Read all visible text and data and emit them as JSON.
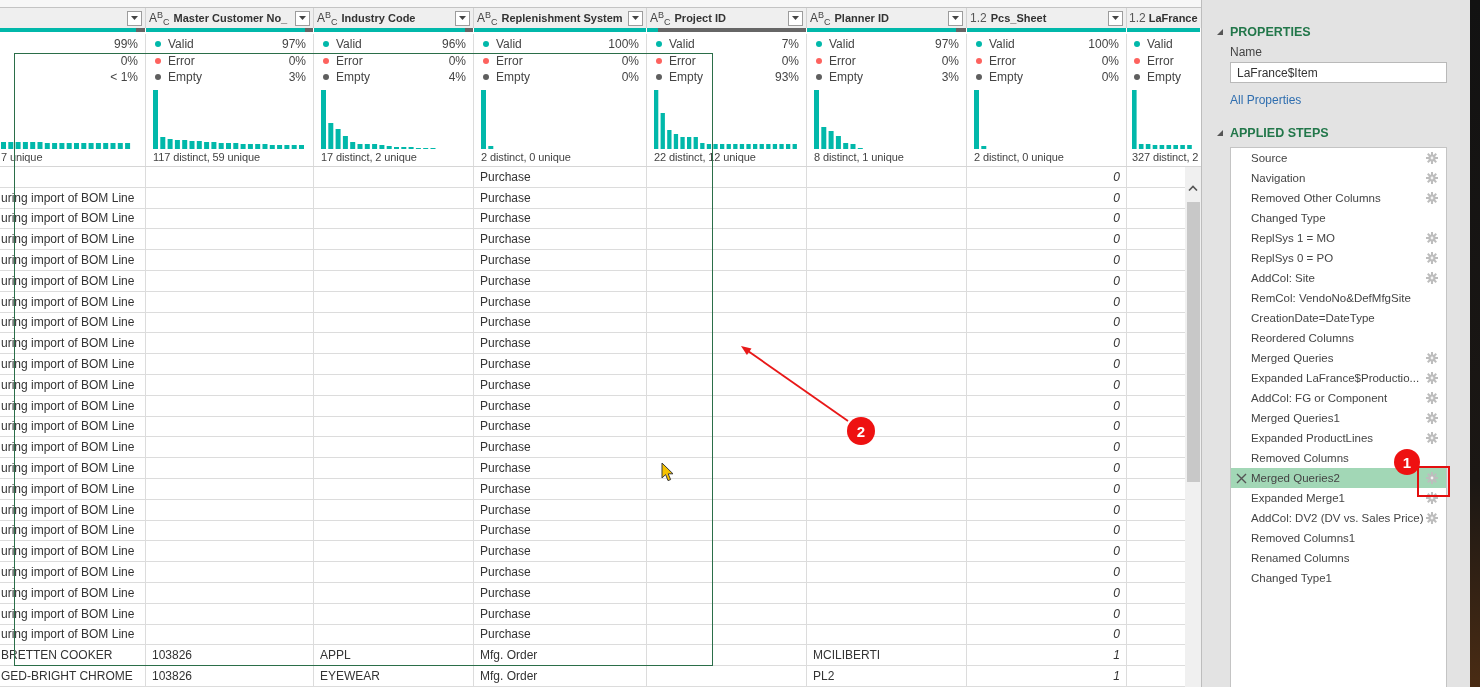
{
  "table": {
    "columns": [
      {
        "kind": "text",
        "has_filter": true,
        "quality_bar": {
          "level": 0.94
        },
        "quality": [
          {
            "value": "99%"
          },
          {
            "value": "0%"
          },
          {
            "value": "< 1%"
          }
        ],
        "distinct": "7 unique"
      },
      {
        "kind": "text",
        "type_label": "A$^{B}$$_{C}$",
        "name": "Master Customer No_",
        "has_filter": true,
        "quality_bar": {
          "level": 0.95
        },
        "quality": [
          {
            "label": "Valid",
            "value": "97%",
            "color": "#01b8aa"
          },
          {
            "label": "Error",
            "value": "0%",
            "color": "#fd625e"
          },
          {
            "label": "Empty",
            "value": "3%",
            "color": "#5f5f5f"
          }
        ],
        "distinct": "117 distinct, 59 unique"
      },
      {
        "kind": "text",
        "type_label": "A$^{B}$$_{C}$",
        "name": "Industry Code",
        "has_filter": true,
        "quality_bar": {
          "level": 0.95
        },
        "quality": [
          {
            "label": "Valid",
            "value": "96%",
            "color": "#01b8aa"
          },
          {
            "label": "Error",
            "value": "0%",
            "color": "#fd625e"
          },
          {
            "label": "Empty",
            "value": "4%",
            "color": "#5f5f5f"
          }
        ],
        "distinct": "17 distinct, 2 unique"
      },
      {
        "kind": "text",
        "type_label": "A$^{B}$$_{C}$",
        "name": "Replenishment System",
        "has_filter": true,
        "quality_bar": {
          "level": 1
        },
        "quality": [
          {
            "label": "Valid",
            "value": "100%",
            "color": "#01b8aa"
          },
          {
            "label": "Error",
            "value": "0%",
            "color": "#fd625e"
          },
          {
            "label": "Empty",
            "value": "0%",
            "color": "#5f5f5f"
          }
        ],
        "distinct": "2 distinct, 0 unique"
      },
      {
        "kind": "text",
        "type_label": "A$^{B}$$_{C}$",
        "name": "Project ID",
        "has_filter": true,
        "quality_bar": {
          "level": 0.07
        },
        "quality": [
          {
            "label": "Valid",
            "value": "7%",
            "color": "#01b8aa"
          },
          {
            "label": "Error",
            "value": "0%",
            "color": "#fd625e"
          },
          {
            "label": "Empty",
            "value": "93%",
            "color": "#5f5f5f"
          }
        ],
        "distinct": "22 distinct, 12 unique"
      },
      {
        "kind": "text",
        "type_label": "A$^{B}$$_{C}$",
        "name": "Planner ID",
        "has_filter": true,
        "quality_bar": {
          "level": 0.94
        },
        "quality": [
          {
            "label": "Valid",
            "value": "97%",
            "color": "#01b8aa"
          },
          {
            "label": "Error",
            "value": "0%",
            "color": "#fd625e"
          },
          {
            "label": "Empty",
            "value": "3%",
            "color": "#5f5f5f"
          }
        ],
        "distinct": "8 distinct, 1 unique"
      },
      {
        "kind": "number",
        "type_label": "1.2",
        "name": "Pcs_Sheet",
        "has_filter": true,
        "quality_bar": {
          "level": 1
        },
        "quality": [
          {
            "label": "Valid",
            "value": "100%",
            "color": "#01b8aa"
          },
          {
            "label": "Error",
            "value": "0%",
            "color": "#fd625e"
          },
          {
            "label": "Empty",
            "value": "0%",
            "color": "#5f5f5f"
          }
        ],
        "distinct": "2 distinct, 0 unique"
      },
      {
        "kind": "number",
        "type_label": "1.2",
        "name": "LaFrance",
        "has_filter": false,
        "quality_bar": {
          "level": 1
        },
        "quality": [
          {
            "label": "Valid",
            "color": "#01b8aa"
          },
          {
            "label": "Error",
            "color": "#fd625e"
          },
          {
            "label": "Empty",
            "color": "#5f5f5f"
          }
        ],
        "distinct": "327 distinct, 2"
      }
    ],
    "rows": [
      {
        "replenishment_system": "Purchase",
        "pcs_sheet": "0"
      },
      {
        "column_1": "uring import of BOM Line",
        "replenishment_system": "Purchase",
        "pcs_sheet": "0"
      },
      {
        "column_1": "uring import of BOM Line",
        "replenishment_system": "Purchase",
        "pcs_sheet": "0"
      },
      {
        "column_1": "uring import of BOM Line",
        "replenishment_system": "Purchase",
        "pcs_sheet": "0"
      },
      {
        "column_1": "uring import of BOM Line",
        "replenishment_system": "Purchase",
        "pcs_sheet": "0"
      },
      {
        "column_1": "uring import of BOM Line",
        "replenishment_system": "Purchase",
        "pcs_sheet": "0"
      },
      {
        "column_1": "uring import of BOM Line",
        "replenishment_system": "Purchase",
        "pcs_sheet": "0"
      },
      {
        "column_1": "uring import of BOM Line",
        "replenishment_system": "Purchase",
        "pcs_sheet": "0"
      },
      {
        "column_1": "uring import of BOM Line",
        "replenishment_system": "Purchase",
        "pcs_sheet": "0"
      },
      {
        "column_1": "uring import of BOM Line",
        "replenishment_system": "Purchase",
        "pcs_sheet": "0"
      },
      {
        "column_1": "uring import of BOM Line",
        "replenishment_system": "Purchase",
        "pcs_sheet": "0"
      },
      {
        "column_1": "uring import of BOM Line",
        "replenishment_system": "Purchase",
        "pcs_sheet": "0"
      },
      {
        "column_1": "uring import of BOM Line",
        "replenishment_system": "Purchase",
        "pcs_sheet": "0"
      },
      {
        "column_1": "uring import of BOM Line",
        "replenishment_system": "Purchase",
        "pcs_sheet": "0"
      },
      {
        "column_1": "uring import of BOM Line",
        "replenishment_system": "Purchase",
        "pcs_sheet": "0"
      },
      {
        "column_1": "uring import of BOM Line",
        "replenishment_system": "Purchase",
        "pcs_sheet": "0"
      },
      {
        "column_1": "uring import of BOM Line",
        "replenishment_system": "Purchase",
        "pcs_sheet": "0"
      },
      {
        "column_1": "uring import of BOM Line",
        "replenishment_system": "Purchase",
        "pcs_sheet": "0"
      },
      {
        "column_1": "uring import of BOM Line",
        "replenishment_system": "Purchase",
        "pcs_sheet": "0"
      },
      {
        "column_1": "uring import of BOM Line",
        "replenishment_system": "Purchase",
        "pcs_sheet": "0"
      },
      {
        "column_1": "uring import of BOM Line",
        "replenishment_system": "Purchase",
        "pcs_sheet": "0"
      },
      {
        "column_1": "uring import of BOM Line",
        "replenishment_system": "Purchase",
        "pcs_sheet": "0"
      },
      {
        "column_1": "uring import of BOM Line",
        "replenishment_system": "Purchase",
        "pcs_sheet": "0"
      },
      {
        "column_1": "BRETTEN COOKER",
        "master_customer_no": "103826",
        "industry_code": "APPL",
        "replenishment_system": "Mfg. Order",
        "planner_id": "MCILIBERTI",
        "pcs_sheet": "1"
      },
      {
        "column_1": "GED-BRIGHT CHROME",
        "master_customer_no": "103826",
        "industry_code": "EYEWEAR",
        "replenishment_system": "Mfg. Order",
        "planner_id": "PL2",
        "pcs_sheet": "1"
      }
    ]
  },
  "query_settings": {
    "properties": {
      "title": "PROPERTIES",
      "name_label": "Name",
      "name_value": "LaFrance$Item",
      "link": "All Properties"
    },
    "applied_steps": {
      "title": "APPLIED STEPS",
      "steps": [
        {
          "label": "Source",
          "has_settings": true,
          "selected": false
        },
        {
          "label": "Navigation",
          "has_settings": true,
          "selected": false
        },
        {
          "label": "Removed Other Columns",
          "has_settings": true,
          "selected": false
        },
        {
          "label": "Changed Type",
          "has_settings": false,
          "selected": false
        },
        {
          "label": "ReplSys 1 = MO",
          "has_settings": true,
          "selected": false
        },
        {
          "label": "ReplSys 0 = PO",
          "has_settings": true,
          "selected": false
        },
        {
          "label": "AddCol: Site",
          "has_settings": true,
          "selected": false
        },
        {
          "label": "RemCol: VendoNo&DefMfgSite",
          "has_settings": false,
          "selected": false
        },
        {
          "label": "CreationDate=DateType",
          "has_settings": false,
          "selected": false
        },
        {
          "label": "Reordered Columns",
          "has_settings": false,
          "selected": false
        },
        {
          "label": "Merged Queries",
          "has_settings": true,
          "selected": false
        },
        {
          "label": "Expanded LaFrance$Productio...",
          "has_settings": true,
          "selected": false
        },
        {
          "label": "AddCol: FG or Component",
          "has_settings": true,
          "selected": false
        },
        {
          "label": "Merged Queries1",
          "has_settings": true,
          "selected": false
        },
        {
          "label": "Expanded ProductLines",
          "has_settings": true,
          "selected": false
        },
        {
          "label": "Removed Columns",
          "has_settings": false,
          "selected": false
        },
        {
          "label": "Merged Queries2",
          "has_settings": true,
          "selected": true
        },
        {
          "label": "Expanded Merge1",
          "has_settings": true,
          "selected": false
        },
        {
          "label": "AddCol: DV2 (DV vs. Sales Price)",
          "has_settings": true,
          "selected": false
        },
        {
          "label": "Removed Columns1",
          "has_settings": false,
          "selected": false
        },
        {
          "label": "Renamed Columns",
          "has_settings": false,
          "selected": false
        },
        {
          "label": "Changed Type1",
          "has_settings": false,
          "selected": false
        }
      ]
    }
  },
  "annotations": [
    {
      "kind": "box",
      "label": "1"
    },
    {
      "kind": "arrow",
      "label": "2"
    }
  ]
}
